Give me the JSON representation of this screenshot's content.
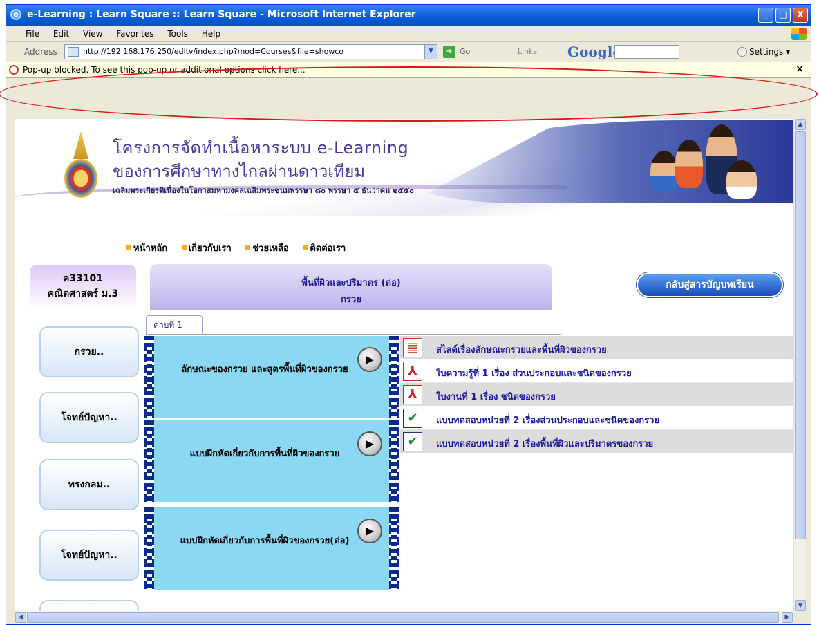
{
  "window": {
    "title": "e-Learning : Learn Square :: Learn Square - Microsoft Internet Explorer",
    "controls": [
      "_",
      "□",
      "X"
    ]
  },
  "menu": [
    "File",
    "Edit",
    "View",
    "Favorites",
    "Tools",
    "Help"
  ],
  "address": {
    "label": "Address",
    "url": "http://192.168.176.250/edltv/index.php?mod=Courses&file=showco",
    "go": "Go",
    "links": "Links",
    "google": "Google",
    "settings": "Settings"
  },
  "popup": {
    "text": "Pop-up blocked. To see this pop-up or additional options click here...",
    "close": "×"
  },
  "banner": {
    "line1": "โครงการจัดทำเนื้อหาระบบ e-Learning",
    "line2": "ของการศึกษาทางไกลผ่านดาวเทียม",
    "line3": "เฉลิมพระเกียรติเนื่องในโอกาสมหามงคลเฉลิมพระชนมพรรษา ๘๐ พรรษา ๕ ธันวาคม ๒๕๕๐"
  },
  "nav": [
    "หน้าหลัก",
    "เกี่ยวกับเรา",
    "ช่วยเหลือ",
    "ติดต่อเรา"
  ],
  "course": {
    "code": "ค33101",
    "name": "คณิตศาสตร์ ม.3"
  },
  "lesson": {
    "title": "พื้นที่ผิวและปริมาตร (ต่อ)",
    "subtitle": "กรวย"
  },
  "back_button": "กลับสู่สารบัญบทเรียน",
  "sidebar": [
    "กรวย..",
    "โจทย์ปัญหา..",
    "ทรงกลม..",
    "โจทย์ปัญหา.."
  ],
  "tab": "คาบที่ 1",
  "videos": [
    {
      "title": "ลักษณะของกรวย และสูตรพื้นที่ผิวของกรวย"
    },
    {
      "title": "แบบฝึกหัดเกี่ยวกับการพื้นที่ผิวของกรวย"
    },
    {
      "title": "แบบฝึกหัดเกี่ยวกับการพื้นที่ผิวของกรวย(ต่อ)"
    }
  ],
  "resources": [
    {
      "label": "สไลด์เรื่องลักษณะกรวยและพื้นที่ผิวของกรวย",
      "icon": "slide-icon"
    },
    {
      "label": "ใบความรู้ที่ 1 เรื่อง ส่วนประกอบและชนิดของกรวย",
      "icon": "pdf-icon"
    },
    {
      "label": "ใบงานที่ 1 เรื่อง ชนิดของกรวย",
      "icon": "pdf-icon"
    },
    {
      "label": "แบบทดสอบหน่วยที่ 2 เรื่องส่วนประกอบและชนิดของกรวย",
      "icon": "quiz-icon"
    },
    {
      "label": "แบบทดสอบหน่วยที่ 2 เรื่องพื้นที่ผิวและปริมาตรของกรวย",
      "icon": "quiz-icon"
    }
  ],
  "colors": {
    "titlebar": "#0a5fd8",
    "popup_bg": "#ffffe1",
    "film": "#8ad8f4",
    "highlight_ellipse": "#d81818"
  }
}
